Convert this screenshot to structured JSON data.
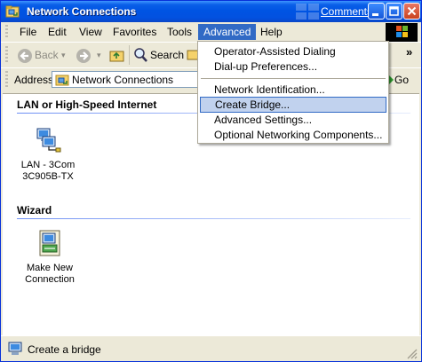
{
  "window": {
    "title": "Network Connections",
    "comments_link": "Comments?",
    "title_colors": {
      "top": "#3d95ff",
      "main": "#0054e3"
    }
  },
  "menubar": {
    "items": [
      "File",
      "Edit",
      "View",
      "Favorites",
      "Tools",
      "Advanced",
      "Help"
    ],
    "active": "Advanced"
  },
  "toolbar": {
    "back_label": "Back",
    "search_label": "Search",
    "more_label": "»"
  },
  "address": {
    "label": "Address",
    "value": "Network Connections",
    "go_label": "Go"
  },
  "groups": [
    {
      "header": "LAN or High-Speed Internet",
      "items": [
        {
          "label_line1": "LAN - 3Com",
          "label_line2": "3C905B-TX",
          "icon": "lan-connection-icon"
        }
      ]
    },
    {
      "header": "Wizard",
      "items": [
        {
          "label_line1": "Make New",
          "label_line2": "Connection",
          "icon": "new-connection-wizard-icon"
        }
      ]
    }
  ],
  "advanced_menu": {
    "items": [
      "Operator-Assisted Dialing",
      "Dial-up Preferences...",
      "Network Identification...",
      "Create Bridge...",
      "Advanced Settings...",
      "Optional Networking Components..."
    ],
    "highlighted": "Create Bridge..."
  },
  "status": {
    "text": "Create a bridge"
  },
  "colors": {
    "menu_highlight": "#316ac5",
    "hover_fill": "#c1d2ee",
    "frame": "#ece9d8"
  }
}
